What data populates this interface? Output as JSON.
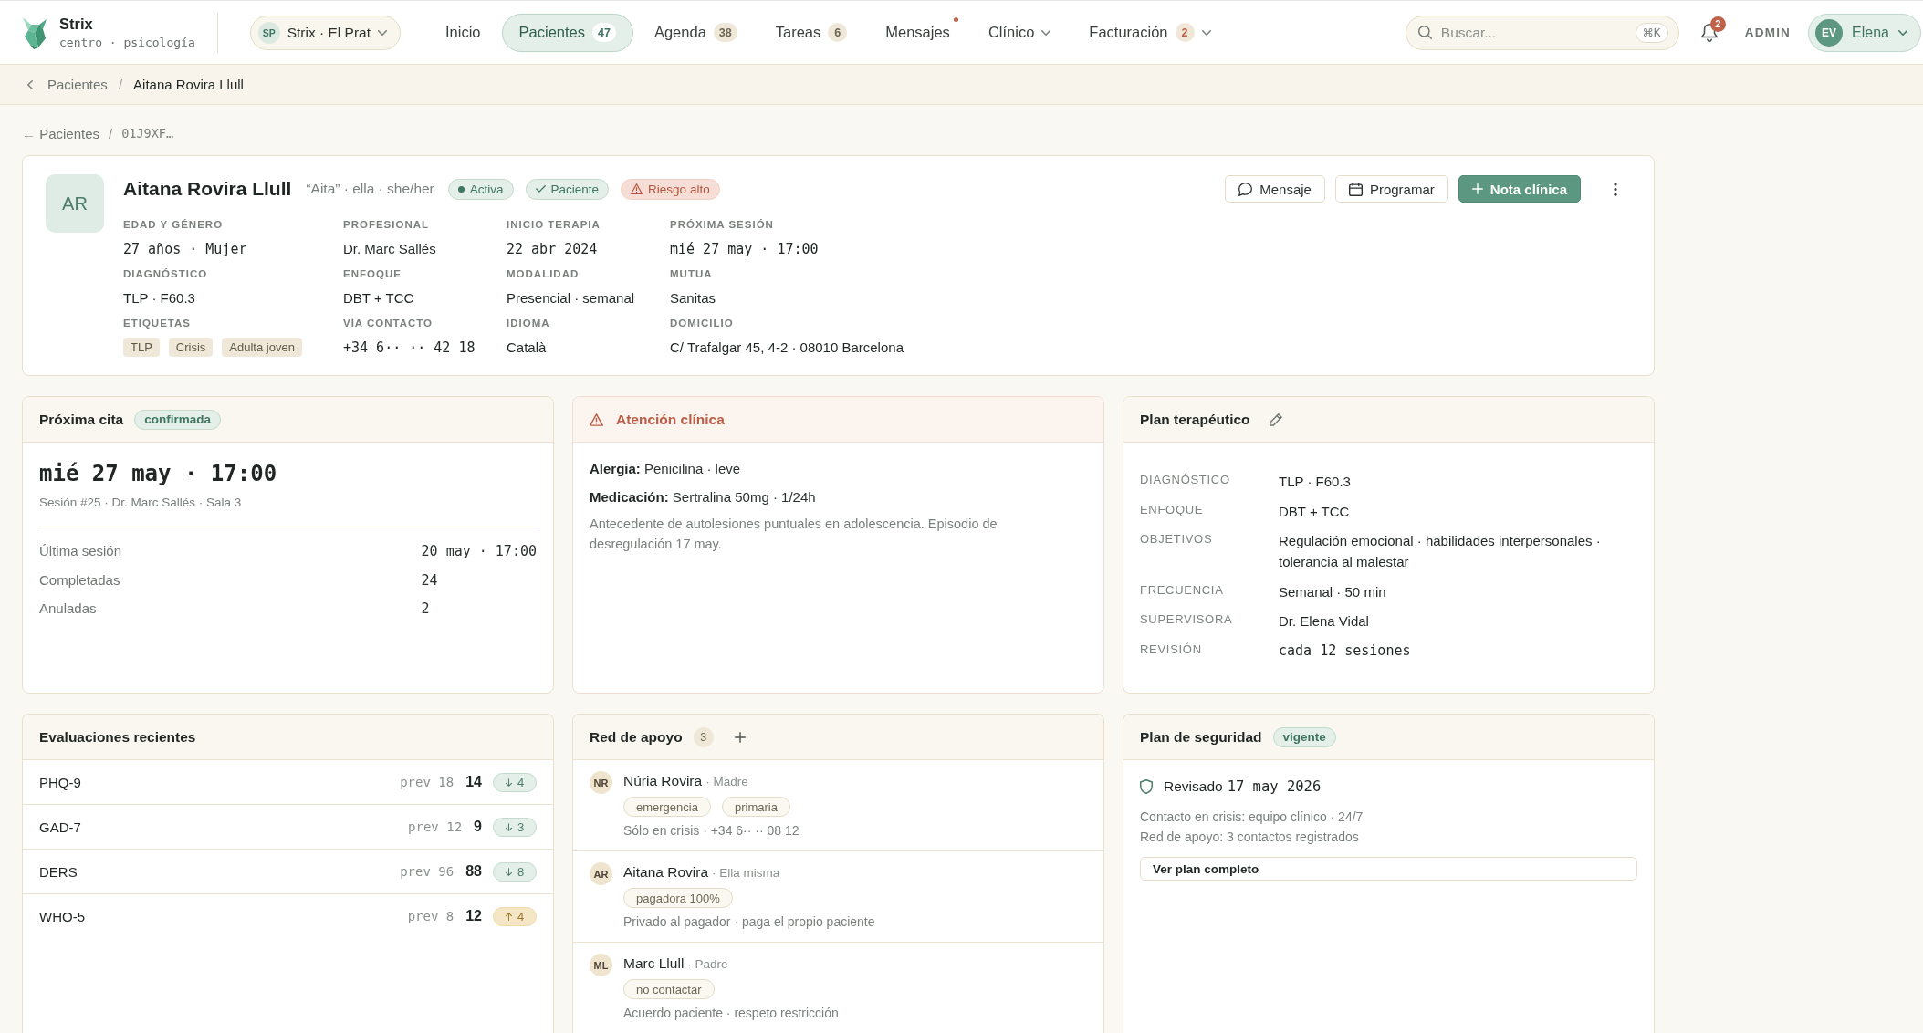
{
  "nav": {
    "brand": {
      "name": "Strix",
      "tagline": "centro · psicología"
    },
    "clinic": {
      "initials": "SP",
      "label": "Strix · El Prat"
    },
    "items": [
      {
        "label": "Inicio",
        "selected": false,
        "unread": false,
        "dropdown": false
      },
      {
        "label": "Pacientes",
        "selected": true,
        "count": "47",
        "alert": false,
        "unread": false,
        "dropdown": false
      },
      {
        "label": "Agenda",
        "selected": false,
        "count": "38",
        "alert": false,
        "unread": false,
        "dropdown": false
      },
      {
        "label": "Tareas",
        "selected": false,
        "count": "6",
        "alert": false,
        "unread": false,
        "dropdown": false
      },
      {
        "label": "Mensajes",
        "selected": false,
        "unread": true,
        "dropdown": false
      },
      {
        "label": "Clínico",
        "selected": false,
        "unread": false,
        "dropdown": true
      },
      {
        "label": "Facturación",
        "selected": false,
        "count": "2",
        "alert": true,
        "unread": false,
        "dropdown": true
      }
    ],
    "search": {
      "placeholder": "Buscar...",
      "shortcut": "⌘K"
    },
    "notifications": {
      "count": "2"
    },
    "role": "ADMIN",
    "user": {
      "initials": "EV",
      "name": "Elena"
    }
  },
  "breadcrumb": {
    "separator": "/",
    "items": [
      {
        "label": "Pacientes",
        "current": false
      },
      {
        "label": "Aitana Rovira Llull",
        "current": true
      }
    ]
  },
  "record_path": {
    "back": "← Pacientes",
    "separator": "/",
    "code": "01J9XF…"
  },
  "patient": {
    "initials": "AR",
    "name": "Aitana Rovira Llull",
    "aka": "“Aita” · ella · she/her",
    "badges": [
      {
        "label": "Activa",
        "kind": "status"
      },
      {
        "label": "Paciente",
        "kind": "verified"
      },
      {
        "label": "Riesgo alto",
        "kind": "risk"
      }
    ],
    "actions": [
      {
        "label": "Mensaje",
        "kind": "message"
      },
      {
        "label": "Programar",
        "kind": "schedule"
      },
      {
        "label": "Nota clínica",
        "kind": "primary"
      }
    ],
    "fields": [
      {
        "label": "EDAD Y GÉNERO",
        "kind": "mono",
        "value": "27 años · Mujer"
      },
      {
        "label": "PROFESIONAL",
        "kind": "text",
        "value": "Dr. Marc Sallés"
      },
      {
        "label": "INICIO TERAPIA",
        "kind": "mono",
        "value": "22 abr 2024"
      },
      {
        "label": "PRÓXIMA SESIÓN",
        "kind": "mono",
        "value": "mié 27 may · 17:00"
      },
      {
        "label": "DIAGNÓSTICO",
        "kind": "text",
        "value": "TLP · F60.3"
      },
      {
        "label": "ENFOQUE",
        "kind": "text",
        "value": "DBT + TCC"
      },
      {
        "label": "MODALIDAD",
        "kind": "text",
        "value": "Presencial · semanal"
      },
      {
        "label": "MUTUA",
        "kind": "text",
        "value": "Sanitas"
      },
      {
        "label": "ETIQUETAS",
        "kind": "tags",
        "tags": [
          "TLP",
          "Crisis",
          "Adulta joven"
        ]
      },
      {
        "label": "VÍA CONTACTO",
        "kind": "mono",
        "value": "+34 6·· ·· 42 18"
      },
      {
        "label": "IDIOMA",
        "kind": "text",
        "value": "Català"
      },
      {
        "label": "DOMICILIO",
        "kind": "text",
        "value": "C/ Trafalgar 45, 4-2 · 08010 Barcelona"
      }
    ]
  },
  "next_appointment": {
    "title": "Próxima cita",
    "status": "confirmada",
    "when": "mié 27 may · 17:00",
    "details": "Sesión #25 · Dr. Marc Sallés · Sala 3",
    "stats": [
      {
        "label": "Última sesión",
        "value": "20 may · 17:00"
      },
      {
        "label": "Completadas",
        "value": "24"
      },
      {
        "label": "Anuladas",
        "value": "2"
      }
    ]
  },
  "clinical_alert": {
    "title": "Atención clínica",
    "lines": [
      "**Alergia:** Penicilina · leve",
      "**Medicación:** Sertralina 50mg · 1/24h"
    ],
    "note": "Antecedente de autolesiones puntuales en adolescencia. Episodio de desregulación 17 may."
  },
  "treatment_plan": {
    "title": "Plan terapéutico",
    "rows": [
      {
        "label": "DIAGNÓSTICO",
        "kind": "text",
        "value": "TLP · F60.3"
      },
      {
        "label": "ENFOQUE",
        "kind": "text",
        "value": "DBT + TCC"
      },
      {
        "label": "OBJETIVOS",
        "kind": "text",
        "value": "Regulación emocional · habilidades interpersonales · tolerancia al malestar"
      },
      {
        "label": "FRECUENCIA",
        "kind": "text",
        "value": "Semanal · 50 min"
      },
      {
        "label": "SUPERVISORA",
        "kind": "text",
        "value": "Dr. Elena Vidal"
      },
      {
        "label": "REVISIÓN",
        "kind": "mono",
        "value": "cada 12 sesiones"
      }
    ]
  },
  "assessments": {
    "title": "Evaluaciones recientes",
    "rows": [
      {
        "name": "PHQ-9",
        "previous": "prev 18",
        "score": "14",
        "change": "4",
        "increase": false
      },
      {
        "name": "GAD-7",
        "previous": "prev 12",
        "score": "9",
        "change": "3",
        "increase": false
      },
      {
        "name": "DERS",
        "previous": "prev 96",
        "score": "88",
        "change": "8",
        "increase": false
      },
      {
        "name": "WHO-5",
        "previous": "prev 8",
        "score": "12",
        "change": "4",
        "increase": true
      }
    ]
  },
  "support_network": {
    "title": "Red de apoyo",
    "count": "3",
    "contacts": [
      {
        "initials": "NR",
        "name": "Núria Rovira",
        "relation": "· Madre",
        "tags": [
          "emergencia",
          "primaria"
        ],
        "note": "Sólo en crisis · +34 6·· ·· 08 12"
      },
      {
        "initials": "AR",
        "name": "Aitana Rovira",
        "relation": "· Ella misma",
        "tags": [
          "pagadora 100%"
        ],
        "note": "Privado al pagador · paga el propio paciente"
      },
      {
        "initials": "ML",
        "name": "Marc Llull",
        "relation": "· Padre",
        "tags": [
          "no contactar"
        ],
        "note": "Acuerdo paciente · respeto restricción"
      }
    ]
  },
  "safety_plan": {
    "title": "Plan de seguridad",
    "status": "vigente",
    "reviewed_label": "Revisado",
    "reviewed_date": "17 may 2026",
    "lines": [
      "Contacto en crisis: equipo clínico · 24/7",
      "Red de apoyo: 3 contactos registrados"
    ],
    "button": "Ver plan completo"
  }
}
